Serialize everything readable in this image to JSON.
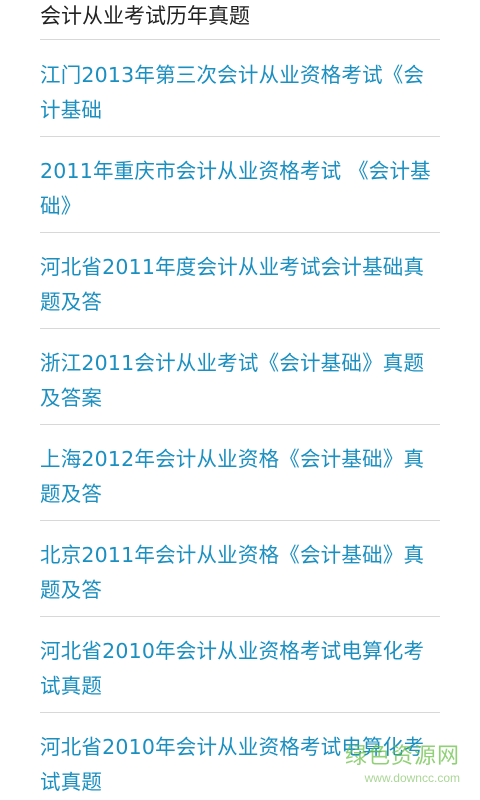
{
  "header": {
    "title": "会计从业考试历年真题"
  },
  "list": {
    "items": [
      "江门2013年第三次会计从业资格考试《会计基础",
      "2011年重庆市会计从业资格考试 《会计基础》",
      "河北省2011年度会计从业考试会计基础真题及答",
      "浙江2011会计从业考试《会计基础》真题及答案",
      "上海2012年会计从业资格《会计基础》真题及答",
      "北京2011年会计从业资格《会计基础》真题及答",
      "河北省2010年会计从业资格考试电算化考试真题",
      "河北省2010年会计从业资格考试电算化考试真题"
    ]
  },
  "watermark": {
    "text": "绿色资源网",
    "url": "www.downcc.com"
  },
  "colors": {
    "link": "#1a8fc0",
    "divider": "#d8d8d8",
    "header_text": "#222222",
    "watermark": "#6cc24a"
  }
}
